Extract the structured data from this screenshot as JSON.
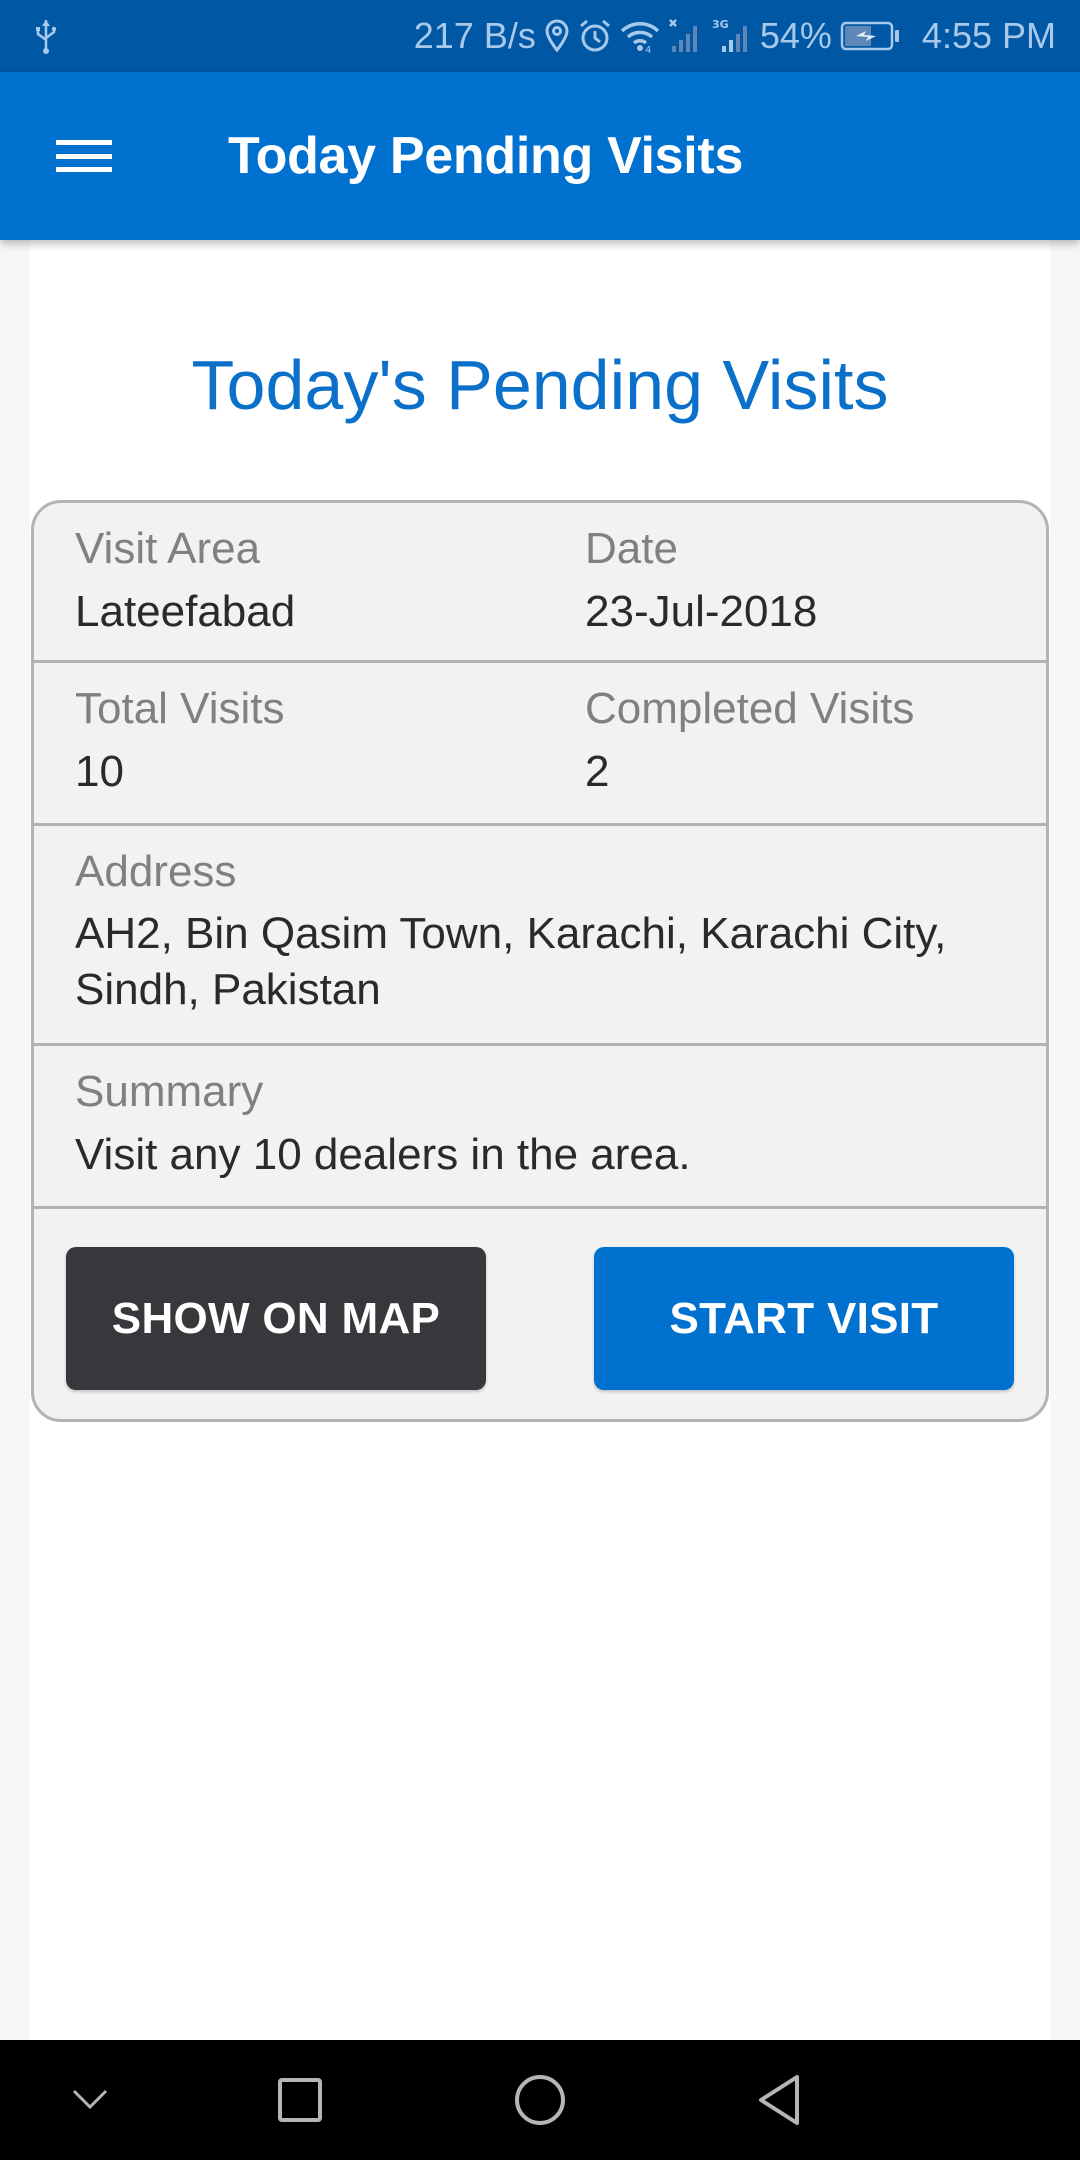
{
  "status_bar": {
    "network_speed": "217 B/s",
    "battery_percent": "54%",
    "time": "4:55 PM",
    "icons": [
      "usb-icon",
      "location-icon",
      "alarm-icon",
      "wifi-icon",
      "signal-no-sim-icon",
      "signal-3g-icon",
      "battery-charging-icon"
    ],
    "network_type": "3G"
  },
  "app_bar": {
    "title": "Today Pending Visits",
    "menu_icon": "hamburger-menu-icon"
  },
  "page": {
    "heading": "Today's Pending Visits"
  },
  "visit": {
    "visit_area_label": "Visit Area",
    "visit_area": "Lateefabad",
    "date_label": "Date",
    "date": "23-Jul-2018",
    "total_visits_label": "Total Visits",
    "total_visits": "10",
    "completed_visits_label": "Completed Visits",
    "completed_visits": "2",
    "address_label": "Address",
    "address": "AH2, Bin Qasim Town, Karachi, Karachi City, Sindh, Pakistan",
    "summary_label": "Summary",
    "summary": "Visit any 10 dealers in the area."
  },
  "actions": {
    "show_on_map": "SHOW ON MAP",
    "start_visit": "START VISIT"
  },
  "nav_bar": {
    "buttons": [
      "hide-nav-icon",
      "recents-icon",
      "home-icon",
      "back-icon"
    ]
  },
  "colors": {
    "status_bar": "#0057a4",
    "primary": "#0071cf",
    "heading": "#0a70c9",
    "dark_button": "#38373c",
    "card_bg": "#f2f2f2",
    "card_border": "#b3b3b3"
  }
}
